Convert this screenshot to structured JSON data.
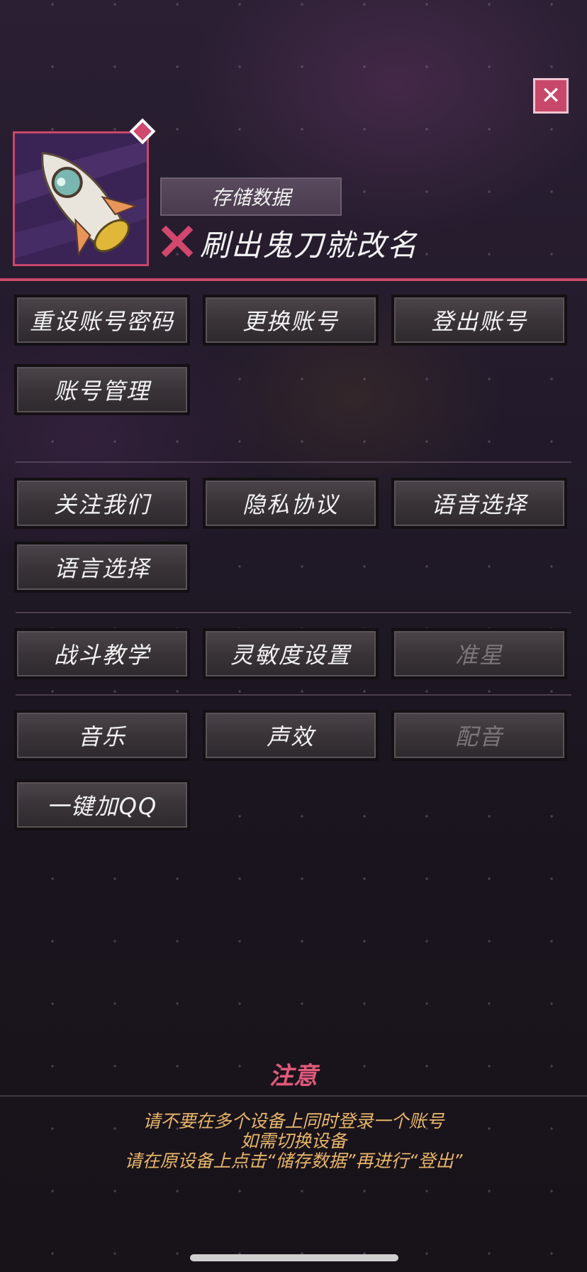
{
  "header": {
    "close_label": "✕",
    "save_button": "存储数据",
    "username": "刷出鬼刀就改名"
  },
  "account_buttons": [
    "重设账号密码",
    "更换账号",
    "登出账号",
    "账号管理"
  ],
  "info_buttons": [
    "关注我们",
    "隐私协议",
    "语音选择",
    "语言选择"
  ],
  "control_buttons": [
    "战斗教学",
    "灵敏度设置",
    "准星"
  ],
  "audio_buttons": [
    "音乐",
    "声效",
    "配音",
    "一键加QQ"
  ],
  "notice": {
    "title": "注意",
    "lines": [
      "请不要在多个设备上同时登录一个账号",
      "如需切换设备",
      "请在原设备上点击“储存数据”再进行“登出”"
    ]
  },
  "colors": {
    "accent": "#c8486a",
    "notice_title": "#e05a7a",
    "notice_text": "#e7b66a",
    "disabled_text": "#7c767a"
  },
  "icons": {
    "close": "close-icon",
    "avatar": "rocket-avatar",
    "name_status": "x-mark-icon"
  }
}
